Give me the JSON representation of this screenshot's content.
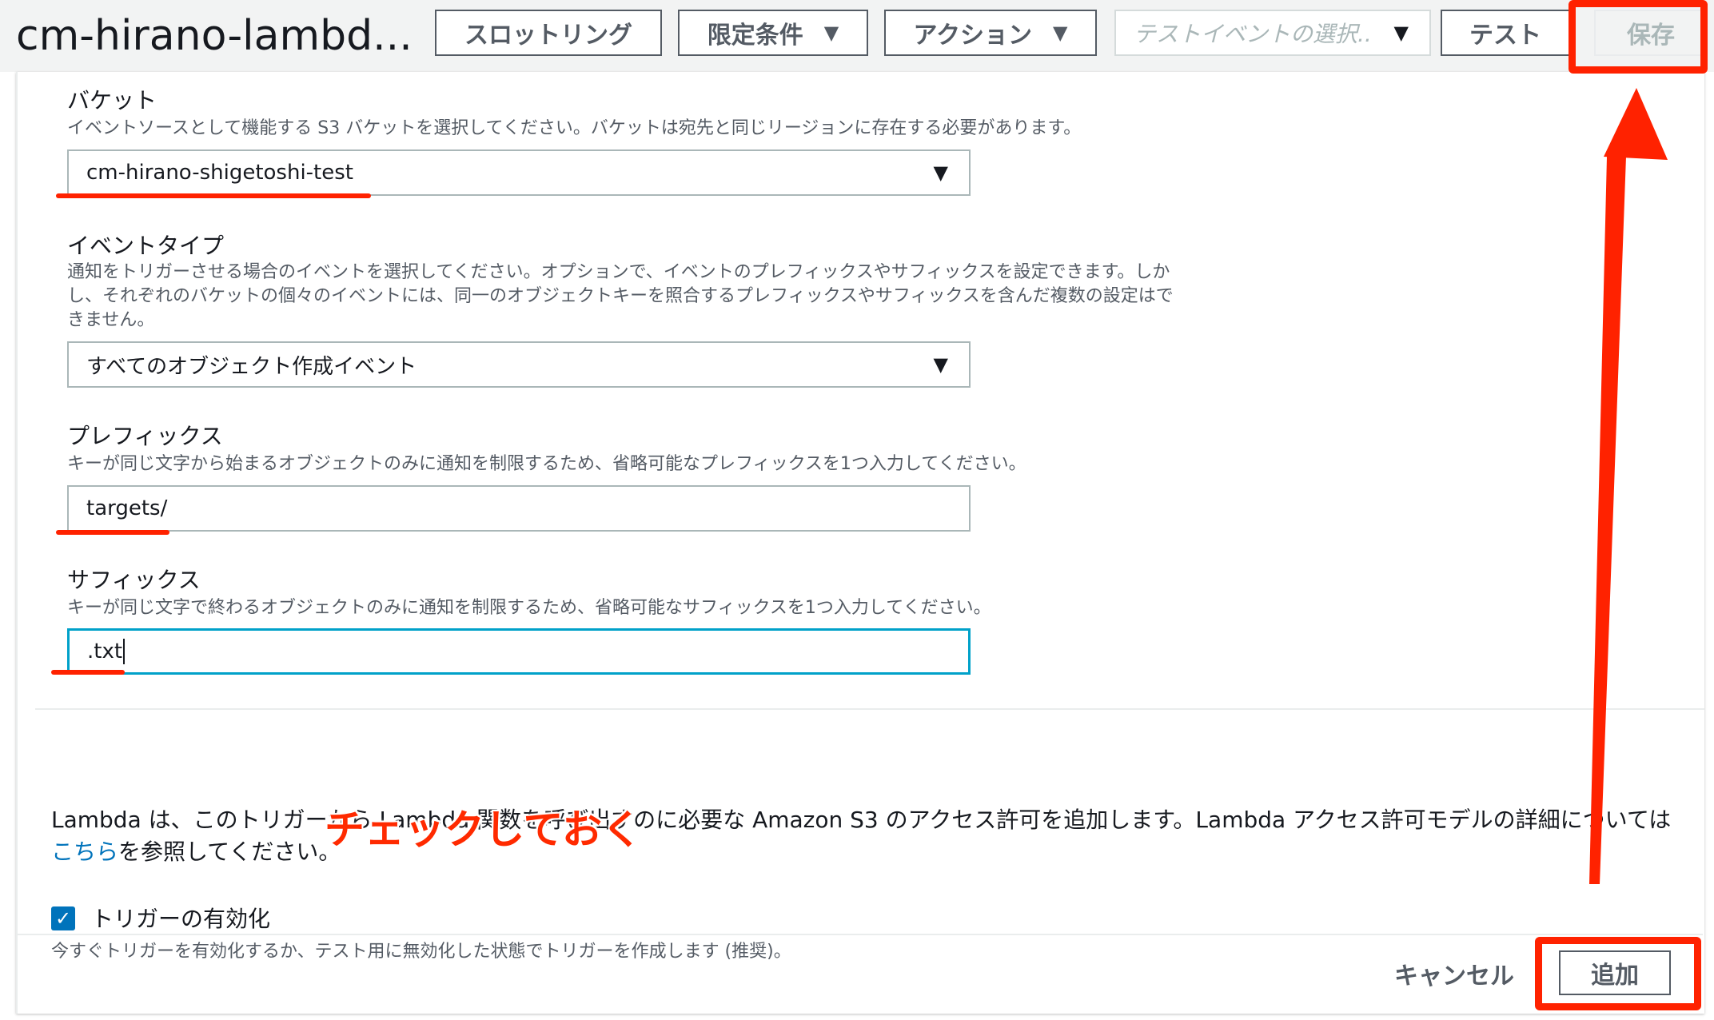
{
  "header": {
    "function_title": "cm-hirano-lambd...",
    "throttle_label": "スロットリング",
    "qualifiers_label": "限定条件",
    "actions_label": "アクション",
    "test_event_placeholder": "テストイベントの選択..",
    "test_label": "テスト",
    "save_label": "保存"
  },
  "form": {
    "bucket": {
      "label": "バケット",
      "description": "イベントソースとして機能する S3 バケットを選択してください。バケットは宛先と同じリージョンに存在する必要があります。",
      "value": "cm-hirano-shigetoshi-test"
    },
    "event_type": {
      "label": "イベントタイプ",
      "description_line1": "通知をトリガーさせる場合のイベントを選択してください。オプションで、イベントのプレフィックスやサフィックスを設定できます。しか",
      "description_line2": "し、それぞれのバケットの個々のイベントには、同一のオブジェクトキーを照合するプレフィックスやサフィックスを含んだ複数の設定はで",
      "description_line3": "きません。",
      "value": "すべてのオブジェクト作成イベント"
    },
    "prefix": {
      "label": "プレフィックス",
      "description": "キーが同じ文字から始まるオブジェクトのみに通知を制限するため、省略可能なプレフィックスを1つ入力してください。",
      "value": "targets/"
    },
    "suffix": {
      "label": "サフィックス",
      "description": "キーが同じ文字で終わるオブジェクトのみに通知を制限するため、省略可能なサフィックスを1つ入力してください。",
      "value": ".txt"
    },
    "info": {
      "text_before_link": "Lambda は、このトリガーから Lambda 関数を呼び出すのに必要な Amazon S3 のアクセス許可を追加します。Lambda アクセス許可モデルの詳細については",
      "link_text": "こちら",
      "text_after_link": "を参照してください。"
    },
    "enable_trigger": {
      "label": "トリガーの有効化",
      "checked": true,
      "description": "今すぐトリガーを有効化するか、テスト用に無効化した状態でトリガーを作成します (推奨)。"
    }
  },
  "annotation": {
    "note": "チェックしておく"
  },
  "footer": {
    "cancel_label": "キャンセル",
    "add_label": "追加"
  },
  "colors": {
    "annotation_red": "#ff2200",
    "link_blue": "#0073bb",
    "focus_blue": "#00a1c9"
  }
}
